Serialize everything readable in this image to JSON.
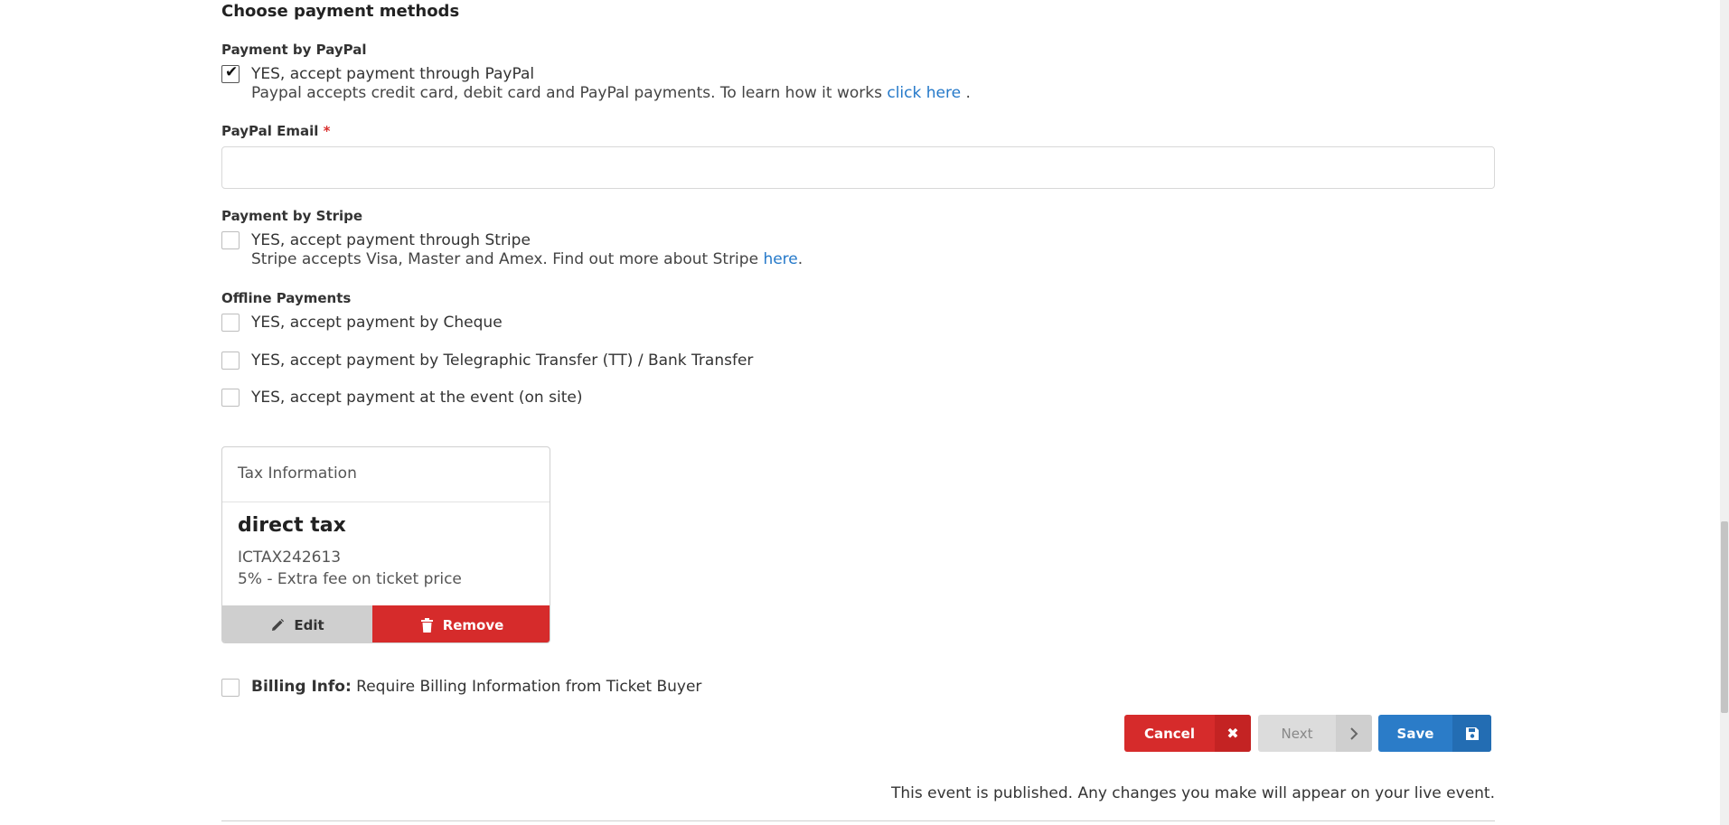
{
  "section": {
    "title": "Choose payment methods"
  },
  "paypal": {
    "label": "Payment by PayPal",
    "checkbox_label": "YES, accept payment through PayPal",
    "checked": true,
    "desc": "Paypal accepts credit card, debit card and PayPal payments. To learn how it works",
    "link_text": "click here",
    "link_suffix": " .",
    "email_label": "PayPal Email",
    "email_required_mark": "*",
    "email_value": ""
  },
  "stripe": {
    "label": "Payment by Stripe",
    "checkbox_label": "YES, accept payment through Stripe",
    "checked": false,
    "desc": "Stripe accepts Visa, Master and Amex. Find out more about Stripe",
    "link_text": "here",
    "link_suffix": "."
  },
  "offline": {
    "label": "Offline Payments",
    "options": [
      {
        "label": "YES, accept payment by Cheque",
        "checked": false
      },
      {
        "label": "YES, accept payment by Telegraphic Transfer (TT) / Bank Transfer",
        "checked": false
      },
      {
        "label": "YES, accept payment at the event (on site)",
        "checked": false
      }
    ]
  },
  "tax": {
    "header": "Tax Information",
    "name": "direct tax",
    "code": "ICTAX242613",
    "rate": "5% - Extra fee on ticket price",
    "edit_label": "Edit",
    "remove_label": "Remove"
  },
  "billing": {
    "bold": "Billing Info:",
    "text": " Require Billing Information from Ticket Buyer",
    "checked": false
  },
  "actions": {
    "cancel": "Cancel",
    "next": "Next",
    "save": "Save",
    "icons": {
      "cancel": "close-icon",
      "next": "chevron-right-icon",
      "save": "floppy-disk-icon"
    }
  },
  "notice": "This event is published. Any changes you make will appear on your live event.",
  "colors": {
    "link": "#2579c9",
    "danger": "#d62b2b",
    "primary": "#2b7cc8"
  }
}
